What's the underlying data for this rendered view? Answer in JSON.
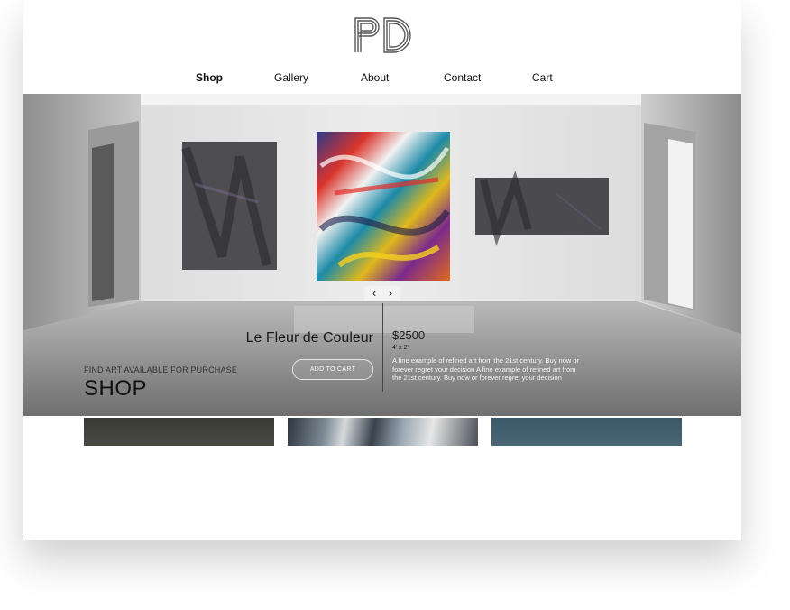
{
  "header": {
    "logo_text": "PD",
    "nav": [
      {
        "label": "Shop",
        "active": true
      },
      {
        "label": "Gallery",
        "active": false
      },
      {
        "label": "About",
        "active": false
      },
      {
        "label": "Contact",
        "active": false
      },
      {
        "label": "Cart",
        "active": false
      }
    ]
  },
  "hero": {
    "prev_icon": "chevron-left-icon",
    "next_icon": "chevron-right-icon",
    "prev_glyph": "‹",
    "next_glyph": "›",
    "title": "Le Fleur de Couleur",
    "add_to_cart_label": "ADD TO CART",
    "price": "$2500",
    "dimensions": "4' x 2'",
    "description": "A fine example of refined art from the 21st century. Buy now or forever regret your decision A fine example of refined art from the 21st century. Buy now or forever regret your decision"
  },
  "shop": {
    "kicker": "FIND ART AVAILABLE FOR PURCHASE",
    "title": "SHOP"
  },
  "colors": {
    "text": "#111111",
    "wall": "#e8e8e8",
    "floor": "#8a8a8a"
  }
}
